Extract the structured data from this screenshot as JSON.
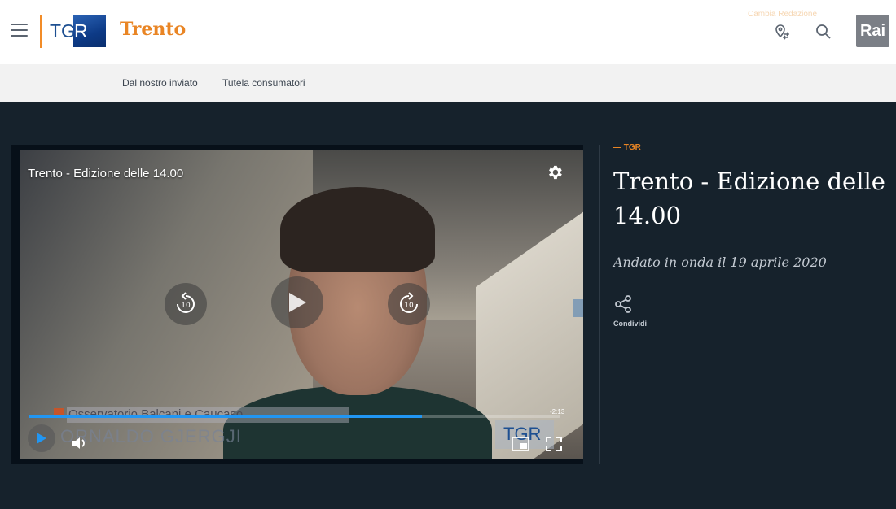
{
  "header": {
    "logo_tgr_left": "TG",
    "logo_tgr_right": "R",
    "region_title": "Trento",
    "change_region": "Cambia Redazione",
    "rai_logo": "Rai",
    "icons": [
      "menu-icon",
      "location-swap-icon",
      "search-icon"
    ]
  },
  "subnav": {
    "items": [
      "Dal nostro inviato",
      "Tutela consumatori"
    ]
  },
  "player": {
    "title": "Trento - Edizione delle 14.00",
    "lower_third_top": "Osservatorio Balcani e Caucaso",
    "lower_third_name": "ORNALDO GJERGJI",
    "tgr_badge": "TGR",
    "remaining_time": "-2:13",
    "progress_fraction": 0.74,
    "skip_back_label": "10",
    "skip_forward_label": "10",
    "accent_color": "#2196f3"
  },
  "info": {
    "kicker": "— TGR",
    "title": "Trento - Edizione delle 14.00",
    "aired": "Andato in onda il 19 aprile 2020",
    "share_label": "Condividi"
  }
}
